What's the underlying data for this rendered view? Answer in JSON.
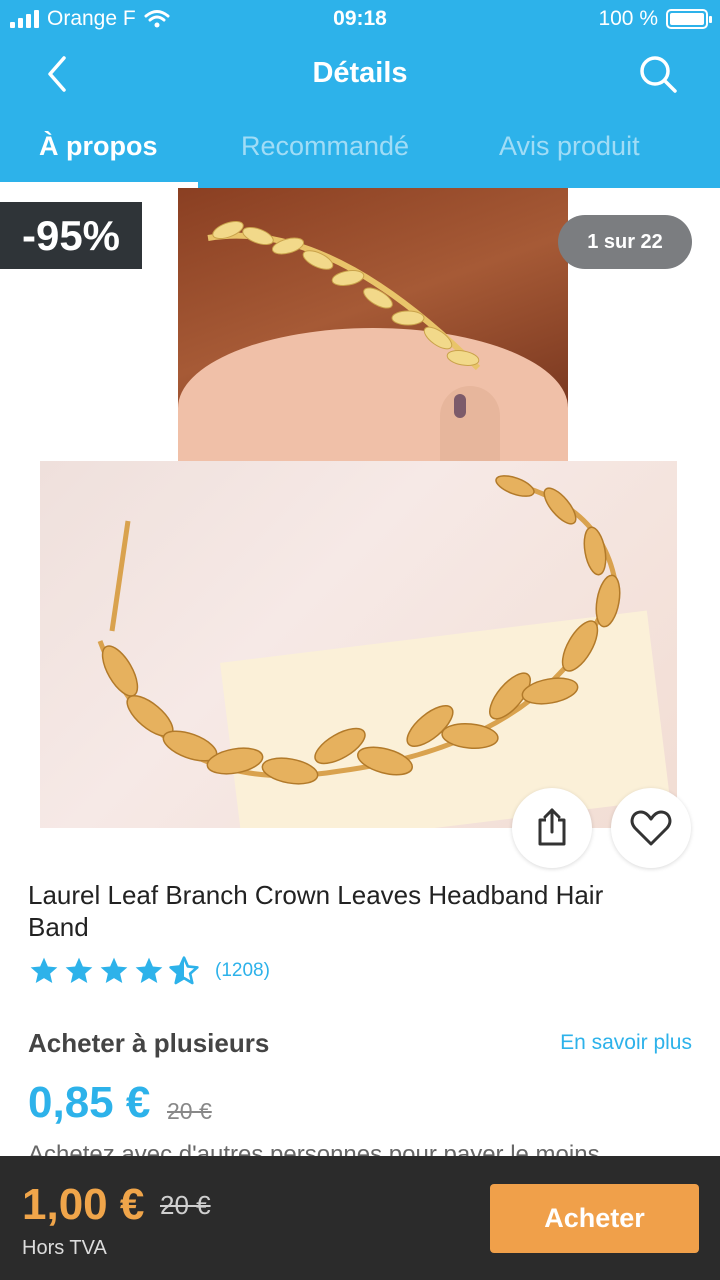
{
  "status_bar": {
    "carrier": "Orange F",
    "time": "09:18",
    "battery": "100 %",
    "battery_level": 1.0
  },
  "nav": {
    "title": "Détails"
  },
  "tabs": [
    {
      "label": "À propos",
      "active": true
    },
    {
      "label": "Recommandé",
      "active": false
    },
    {
      "label": "Avis produit",
      "active": false
    }
  ],
  "gallery": {
    "discount": "-95%",
    "counter": "1 sur 22"
  },
  "product": {
    "title": "Laurel Leaf Branch Crown Leaves Headband Hair Band",
    "rating": 4.5,
    "rating_count": "(1208)"
  },
  "group_buy": {
    "title": "Acheter à plusieurs",
    "learn_more": "En savoir plus",
    "price": "0,85 €",
    "old_price": "20 €",
    "description": "Achetez avec d'autres personnes pour payer le moins"
  },
  "bottom_bar": {
    "price": "1,00 €",
    "old_price": "20 €",
    "note": "Hors TVA",
    "buy_label": "Acheter"
  },
  "colors": {
    "primary": "#2db2ea",
    "accent": "#f0a04a",
    "dark": "#2b2b2b"
  }
}
